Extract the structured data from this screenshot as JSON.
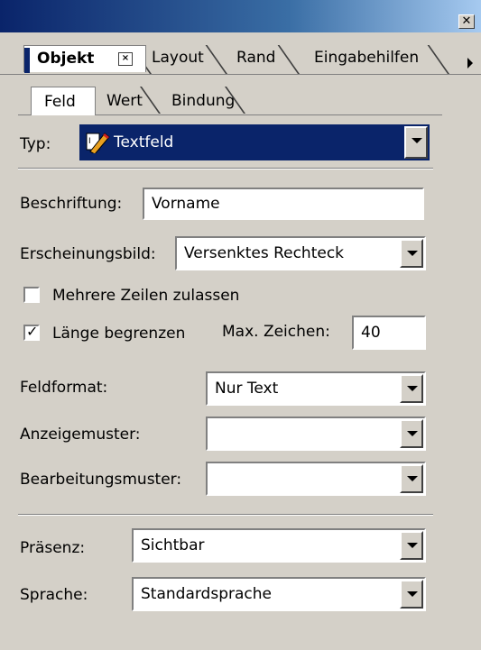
{
  "window": {
    "close_glyph": "✕"
  },
  "top_tabs": [
    {
      "label": "Objekt",
      "active": true
    },
    {
      "label": "Layout"
    },
    {
      "label": "Rand"
    },
    {
      "label": "Eingabehilfen"
    }
  ],
  "inner_tabs": [
    {
      "label": "Feld",
      "active": true
    },
    {
      "label": "Wert"
    },
    {
      "label": "Bindung"
    }
  ],
  "type": {
    "label": "Typ:",
    "value": "Textfeld",
    "icon": "textfield-pen-icon"
  },
  "caption": {
    "label": "Beschriftung:",
    "value": "Vorname"
  },
  "appearance": {
    "label": "Erscheinungsbild:",
    "value": "Versenktes Rechteck"
  },
  "multiline": {
    "label": "Mehrere Zeilen zulassen",
    "checked": false
  },
  "limit_length": {
    "label": "Länge begrenzen",
    "checked": true,
    "max_label": "Max. Zeichen:",
    "max_value": "40"
  },
  "field_format": {
    "label": "Feldformat:",
    "value": "Nur Text"
  },
  "display_pattern": {
    "label": "Anzeigemuster:",
    "value": ""
  },
  "edit_pattern": {
    "label": "Bearbeitungsmuster:",
    "value": ""
  },
  "presence": {
    "label": "Präsenz:",
    "value": "Sichtbar"
  },
  "language": {
    "label": "Sprache:",
    "value": "Standardsprache"
  },
  "colors": {
    "selection_blue": "#0a246a",
    "panel_gray": "#d4d0c8"
  }
}
